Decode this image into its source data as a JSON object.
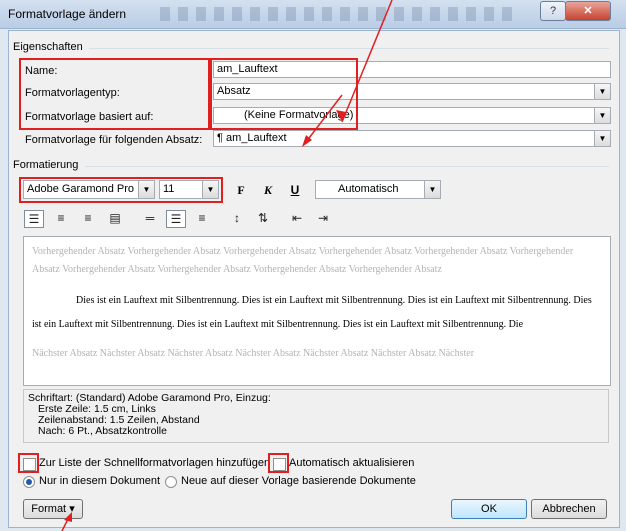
{
  "window": {
    "title": "Formatvorlage ändern",
    "help_glyph": "?",
    "close_glyph": "✕"
  },
  "properties": {
    "group_title": "Eigenschaften",
    "name_label": "Name:",
    "name_value": "am_Lauftext",
    "type_label": "Formatvorlagentyp:",
    "type_value": "Absatz",
    "based_label": "Formatvorlage basiert auf:",
    "based_value": "(Keine Formatvorlage)",
    "next_label": "Formatvorlage für folgenden Absatz:",
    "next_value": "¶ am_Lauftext"
  },
  "formatting": {
    "group_title": "Formatierung",
    "font": "Adobe Garamond Pro",
    "size": "11",
    "bold": "F",
    "italic": "K",
    "underline": "U",
    "color": "Automatisch"
  },
  "preview": {
    "previous": "Vorhergehender Absatz Vorhergehender Absatz Vorhergehender Absatz Vorhergehender Absatz Vorhergehender Absatz Vorhergehender Absatz Vorhergehender Absatz Vorhergehender Absatz Vorhergehender Absatz Vorhergehender Absatz",
    "main": "Dies ist ein Lauftext mit Silbentrennung. Dies ist ein Lauftext mit Silbentrennung. Dies ist ein Lauftext mit Silbentrennung. Dies ist ein Lauftext mit Silbentrennung. Dies ist ein Lauftext mit Silbentrennung. Dies ist ein Lauftext mit Silbentrennung. Die",
    "next": "Nächster Absatz Nächster Absatz Nächster Absatz Nächster Absatz Nächster Absatz Nächster Absatz Nächster"
  },
  "description": {
    "line1": "Schriftart: (Standard) Adobe Garamond Pro, Einzug:",
    "line2": "Erste Zeile:  1.5 cm, Links",
    "line3": "Zeilenabstand:  1.5 Zeilen, Abstand",
    "line4": "Nach:  6 Pt., Absatzkontrolle"
  },
  "options": {
    "add_quick_styles": "Zur Liste der Schnellformatvorlagen hinzufügen",
    "auto_update": "Automatisch aktualisieren",
    "only_document": "Nur in diesem Dokument",
    "new_documents": "Neue auf dieser Vorlage basierende Dokumente"
  },
  "buttons": {
    "format": "Format",
    "ok": "OK",
    "cancel": "Abbrechen"
  },
  "colors": {
    "annotation_red": "#e02020",
    "title_bar": "#c6d6ea",
    "dialog_bg": "#f0f0f0"
  }
}
